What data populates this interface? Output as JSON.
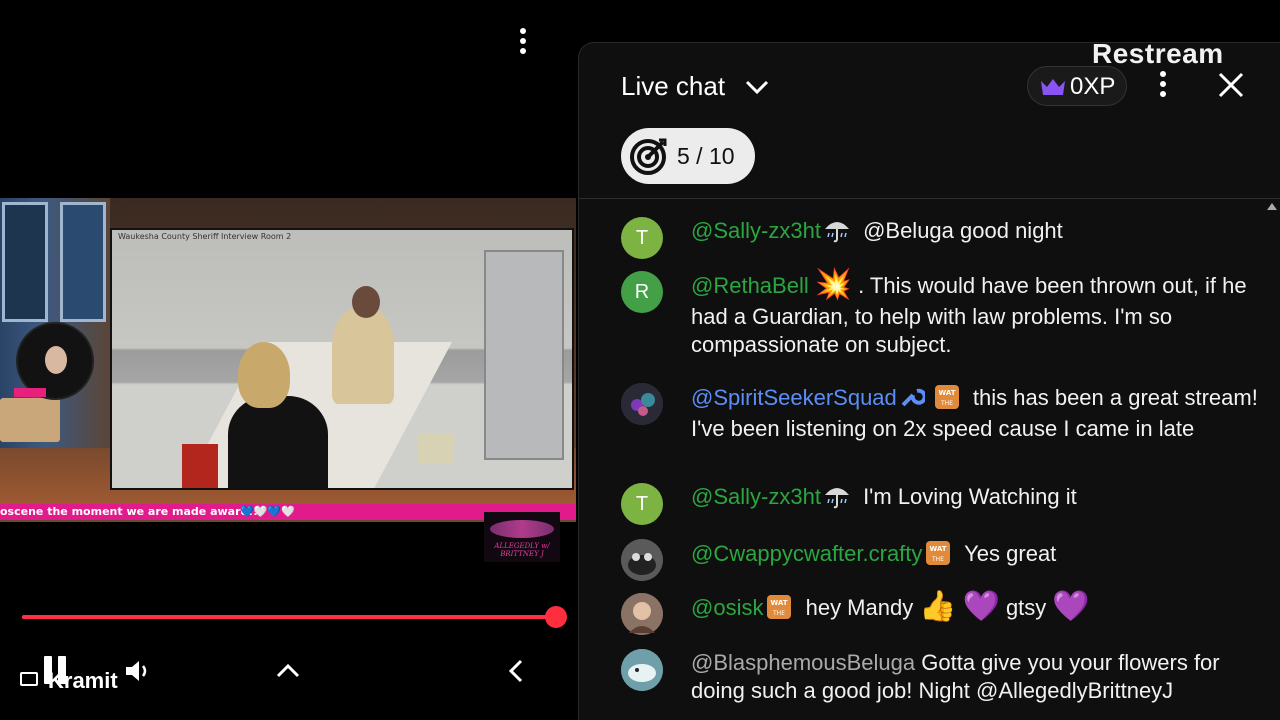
{
  "player": {
    "overlay_caption": "Waukesha County Sheriff Interview Room 2",
    "ticker_text": "oscene the moment we are made aware!!",
    "ticker_hearts": [
      "💙",
      "🤍",
      "💙",
      "🤍"
    ],
    "host_tag": "Brittney J",
    "brand_text": "ALLEGEDLY w/ BRITTNEY J",
    "progress_fraction": 1.0,
    "channel_name": "Kramit"
  },
  "watermark": "Restream",
  "chat": {
    "title": "Live chat",
    "xp_label": "0XP",
    "goal_label": "5 / 10",
    "colors": {
      "author_green": "#2ba640",
      "author_blue": "#5b8ef6",
      "progress_red": "#ff3045",
      "xp_crown": "#8a54f5"
    },
    "messages": [
      {
        "avatar_letter": "T",
        "avatar_color": "#7cb342",
        "author": "@Sally-zx3ht",
        "badge": "umbrella-badge",
        "text": "@Beluga good night",
        "author_style": "green"
      },
      {
        "avatar_letter": "R",
        "avatar_color": "#43a047",
        "author": "@RethaBell",
        "badge": "",
        "emoji": "💥",
        "text": ". This would have been thrown out, if he had a Guardian, to help with law problems. I'm so compassionate on subject.",
        "author_style": "green"
      },
      {
        "avatar_letter": "",
        "avatar_color": "#3a3a44",
        "author": "@SpiritSeekerSquad",
        "badge": "wrench-and-wat-badge",
        "text": "this has been a great stream! I've been listening on 2x speed cause I came in late",
        "author_style": "blue"
      },
      {
        "avatar_letter": "T",
        "avatar_color": "#7cb342",
        "author": "@Sally-zx3ht",
        "badge": "umbrella-badge",
        "text": "I'm Loving Watching it",
        "author_style": "green"
      },
      {
        "avatar_letter": "",
        "avatar_color": "#4a4a4a",
        "author": "@Cwappycwafter.crafty",
        "badge": "wat-badge",
        "text": "Yes great",
        "author_style": "green"
      },
      {
        "avatar_letter": "",
        "avatar_color": "#6b5a52",
        "author": "@osisk",
        "badge": "wat-badge",
        "text_parts": [
          "hey Mandy",
          "👍",
          "💜",
          "gtsy",
          "💜"
        ],
        "author_style": "green"
      },
      {
        "avatar_letter": "",
        "avatar_color": "#5d8a94",
        "author": "@BlasphemousBeluga",
        "badge": "",
        "text": "Gotta give you your flowers for doing such a good job! Night @AllegedlyBrittneyJ",
        "author_style": "grey"
      }
    ]
  }
}
